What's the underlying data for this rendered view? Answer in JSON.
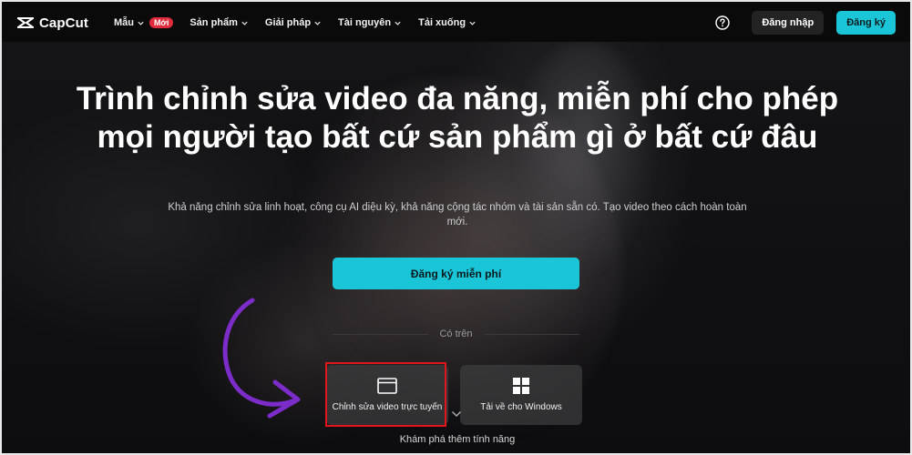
{
  "header": {
    "logo_text": "CapCut",
    "nav": [
      {
        "label": "Mẫu",
        "badge": "Mới"
      },
      {
        "label": "Sản phẩm"
      },
      {
        "label": "Giải pháp"
      },
      {
        "label": "Tài nguyên"
      },
      {
        "label": "Tải xuống"
      }
    ],
    "login_label": "Đăng nhập",
    "signup_label": "Đăng ký"
  },
  "hero": {
    "title": "Trình chỉnh sửa video đa năng, miễn phí cho phép mọi người tạo bất cứ sản phẩm gì ở bất cứ đâu",
    "subtitle": "Khả năng chỉnh sửa linh hoạt, công cụ AI diệu kỳ, khả năng cộng tác nhóm và tài sản sẵn có. Tạo video theo cách hoàn toàn mới.",
    "cta_label": "Đăng ký miễn phí",
    "available_on": "Có trên",
    "platforms": [
      {
        "label": "Chỉnh sửa video trực tuyến",
        "icon": "browser-window-icon"
      },
      {
        "label": "Tải về cho Windows",
        "icon": "windows-icon"
      }
    ],
    "explore_label": "Khám phá thêm tính năng"
  },
  "colors": {
    "accent": "#1ac5d8",
    "badge": "#e02c3c",
    "highlight": "#e0161c",
    "annotation_arrow": "#7b2cc9"
  }
}
